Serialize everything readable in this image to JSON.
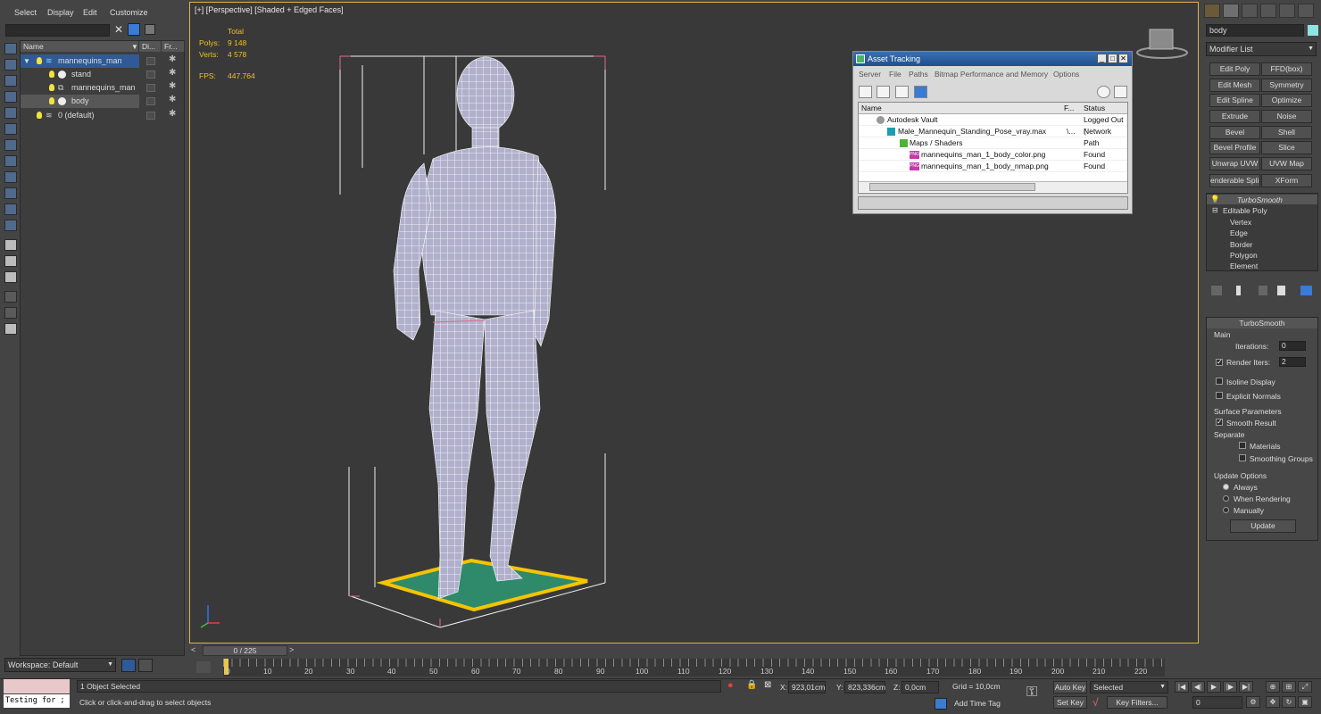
{
  "menus": [
    "Select",
    "Display",
    "Edit",
    "Customize"
  ],
  "explorer": {
    "columns": [
      "Name",
      "Di...",
      "Fr..."
    ],
    "rows": [
      {
        "label": "mannequins_man",
        "depth": 0
      },
      {
        "label": "stand",
        "depth": 1
      },
      {
        "label": "mannequins_man",
        "depth": 1
      },
      {
        "label": "body",
        "depth": 1
      },
      {
        "label": "0 (default)",
        "depth": 0
      }
    ],
    "workspace": "Workspace: Default"
  },
  "viewport": {
    "label": "[+] [Perspective] [Shaded + Edged Faces]",
    "stats": {
      "total_label": "Total",
      "polys_label": "Polys:",
      "polys_value": "9 148",
      "verts_label": "Verts:",
      "verts_value": "4 578",
      "fps_label": "FPS:",
      "fps_value": "447.764"
    }
  },
  "asset_tracking": {
    "title": "Asset Tracking",
    "menu": [
      "Server",
      "File",
      "Paths",
      "Bitmap Performance and Memory",
      "Options"
    ],
    "columns": [
      "Name",
      "F...",
      "Status"
    ],
    "rows": [
      {
        "name": "Autodesk Vault",
        "f": "",
        "status": "Logged Out (",
        "indent": 1,
        "icon": "vault-icon"
      },
      {
        "name": "Male_Mannequin_Standing_Pose_vray.max",
        "f": "\\...",
        "status": "Network Path",
        "indent": 2,
        "icon": "max-file-icon"
      },
      {
        "name": "Maps / Shaders",
        "f": "",
        "status": "",
        "indent": 3,
        "icon": "maps-icon"
      },
      {
        "name": "mannequins_man_1_body_color.png",
        "f": "",
        "status": "Found",
        "indent": 4,
        "icon": "png-icon"
      },
      {
        "name": "mannequins_man_1_body_nmap.png",
        "f": "",
        "status": "Found",
        "indent": 4,
        "icon": "png-icon"
      }
    ],
    "png_badge": "PNG"
  },
  "command_panel": {
    "object_name": "body",
    "modifier_list": "Modifier List",
    "buttons": [
      "Edit Poly",
      "FFD(box)",
      "Edit Mesh",
      "Symmetry",
      "Edit Spline",
      "Optimize",
      "Extrude",
      "Noise",
      "Bevel",
      "Shell",
      "Bevel Profile",
      "Slice",
      "Unwrap UVW",
      "UVW Map",
      "enderable Splin",
      "XForm"
    ],
    "stack": [
      "TurboSmooth",
      "Editable Poly",
      "Vertex",
      "Edge",
      "Border",
      "Polygon",
      "Element"
    ],
    "turbosmooth": {
      "title": "TurboSmooth",
      "main": "Main",
      "iterations_label": "Iterations:",
      "iterations": "0",
      "render_iters_label": "Render Iters:",
      "render_iters": "2",
      "isoline": "Isoline Display",
      "explicit": "Explicit Normals",
      "surface": "Surface Parameters",
      "smooth_result": "Smooth Result",
      "separate": "Separate",
      "materials": "Materials",
      "smoothing_groups": "Smoothing Groups",
      "update_options": "Update Options",
      "always": "Always",
      "when_rendering": "When Rendering",
      "manually": "Manually",
      "update_btn": "Update"
    }
  },
  "timeline": {
    "frame": "0 / 225",
    "ticks": [
      "0",
      "10",
      "20",
      "30",
      "40",
      "50",
      "60",
      "70",
      "80",
      "90",
      "100",
      "110",
      "120",
      "130",
      "140",
      "150",
      "160",
      "170",
      "180",
      "190",
      "200",
      "210",
      "220"
    ]
  },
  "status_bar": {
    "script": "Testing for ;",
    "selected": "1 Object Selected",
    "prompt": "Click or click-and-drag to select objects",
    "x_label": "X:",
    "x": "923,01cm",
    "y_label": "Y:",
    "y": "823,336cm",
    "z_label": "Z:",
    "z": "0,0cm",
    "grid": "Grid = 10,0cm",
    "add_time_tag": "Add Time Tag",
    "auto_key": "Auto Key",
    "set_key": "Set Key",
    "selected_dropdown": "Selected",
    "key_filters": "Key Filters...",
    "frame_field": "0"
  }
}
